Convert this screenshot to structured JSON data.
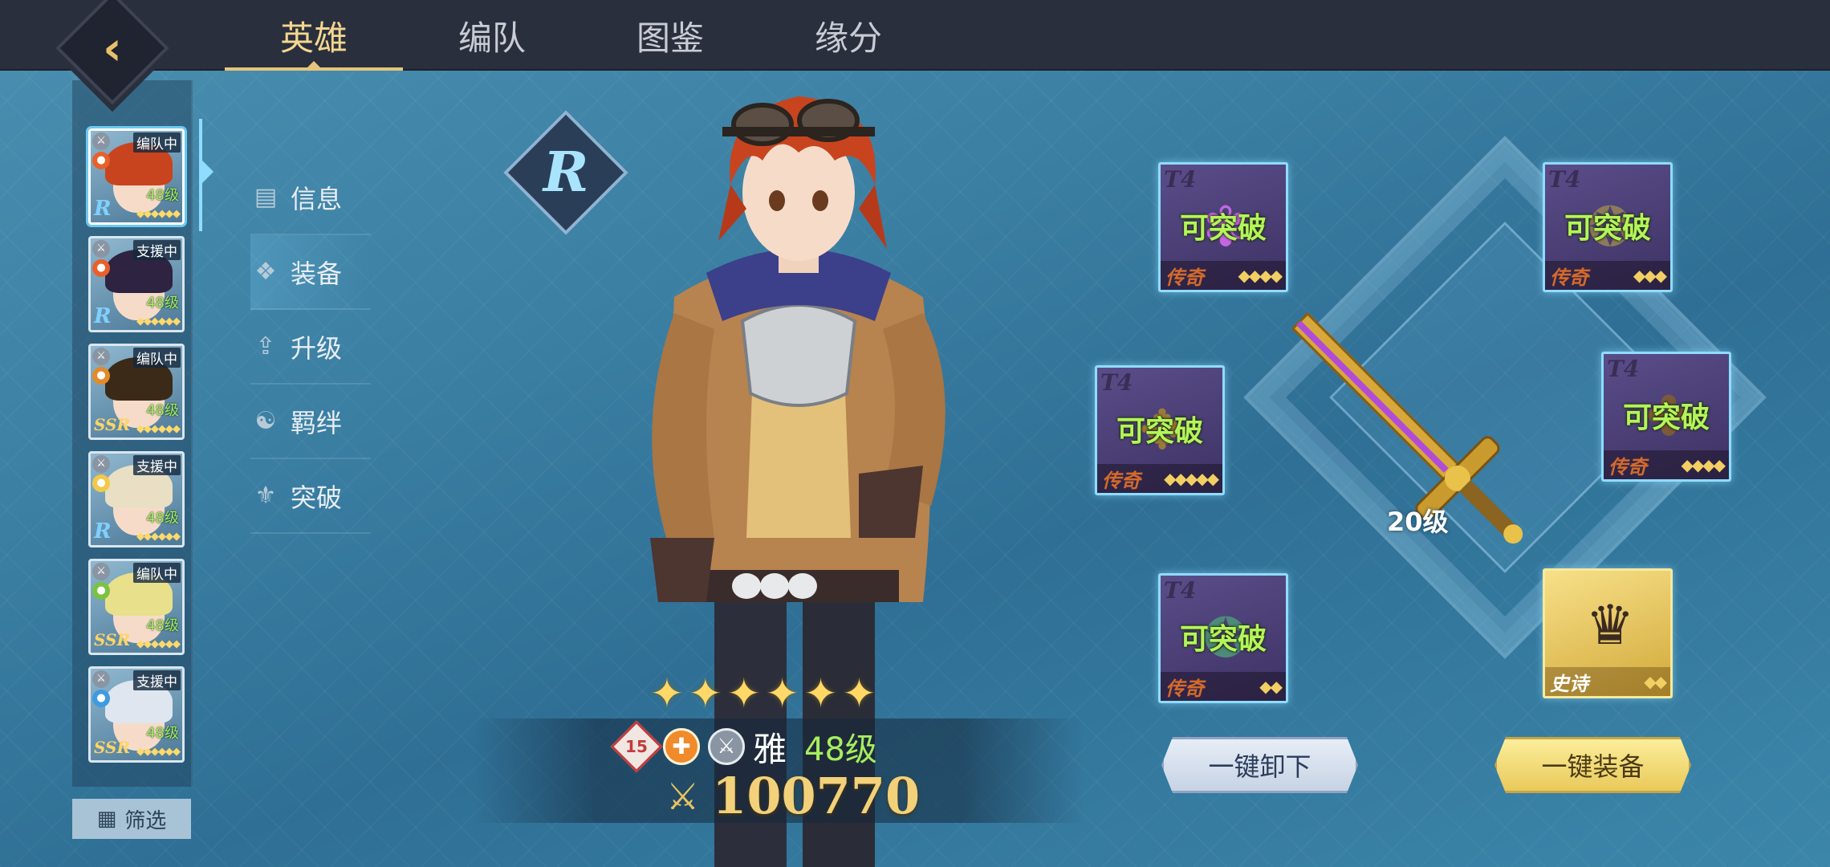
{
  "tabs": [
    {
      "label": "英雄",
      "active": true
    },
    {
      "label": "编队",
      "active": false
    },
    {
      "label": "图鉴",
      "active": false
    },
    {
      "label": "缘分",
      "active": false
    }
  ],
  "back_icon": "back-arrow-icon",
  "hero_list": [
    {
      "status": "编队中",
      "level": "48级",
      "rarity": "R",
      "element": "fire",
      "hair_color": "#c8441f"
    },
    {
      "status": "支援中",
      "level": "48级",
      "rarity": "R",
      "element": "fire",
      "hair_color": "#2e2340"
    },
    {
      "status": "编队中",
      "level": "48级",
      "rarity": "SSR",
      "element": "earth",
      "hair_color": "#3b2a18"
    },
    {
      "status": "支援中",
      "level": "48级",
      "rarity": "R",
      "element": "light",
      "hair_color": "#e9dfc5"
    },
    {
      "status": "编队中",
      "level": "48级",
      "rarity": "SSR",
      "element": "wind",
      "hair_color": "#e8e08a"
    },
    {
      "status": "支援中",
      "level": "48级",
      "rarity": "SSR",
      "element": "water",
      "hair_color": "#dfe6ef"
    }
  ],
  "filter_label": "筛选",
  "side_menu": [
    {
      "label": "信息",
      "icon": "book-icon",
      "active": false
    },
    {
      "label": "装备",
      "icon": "equipment-icon",
      "active": true
    },
    {
      "label": "升级",
      "icon": "upgrade-icon",
      "active": false
    },
    {
      "label": "羁绊",
      "icon": "bond-icon",
      "active": false
    },
    {
      "label": "突破",
      "icon": "breakthrough-icon",
      "active": false
    }
  ],
  "hero": {
    "rarity": "R",
    "stars": 6,
    "breakthrough": "15",
    "name": "雅",
    "level": "48级",
    "power": "100770"
  },
  "equipment": [
    {
      "slot": "top-left",
      "tier": "T4",
      "status": "可突破",
      "quality": "传奇",
      "stars": 4
    },
    {
      "slot": "top-right",
      "tier": "T4",
      "status": "可突破",
      "quality": "传奇",
      "stars": 3
    },
    {
      "slot": "mid-left",
      "tier": "T4",
      "status": "可突破",
      "quality": "传奇",
      "stars": 5
    },
    {
      "slot": "mid-right",
      "tier": "T4",
      "status": "可突破",
      "quality": "传奇",
      "stars": 4
    },
    {
      "slot": "bottom-left",
      "tier": "T4",
      "status": "可突破",
      "quality": "传奇",
      "stars": 2
    },
    {
      "slot": "bottom-right",
      "tier": "",
      "status": "",
      "quality": "史诗",
      "stars": 2
    }
  ],
  "weapon": {
    "level": "20级"
  },
  "buttons": {
    "unequip": "一键卸下",
    "equip": "一键装备"
  },
  "colors": {
    "accent_gold": "#e6c57a",
    "level_green": "#a6ef5f",
    "breakable_green": "#b3f55a"
  }
}
